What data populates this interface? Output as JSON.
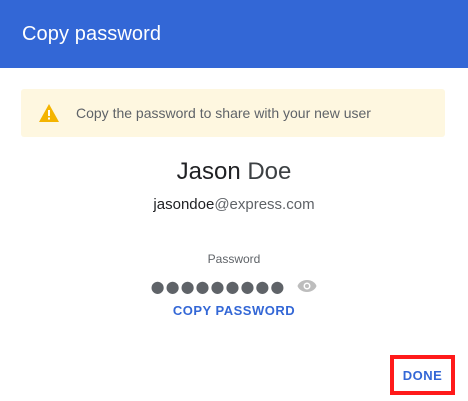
{
  "dialog": {
    "title": "Copy password"
  },
  "notice": {
    "icon": "warning-icon",
    "icon_color": "#f4b400",
    "text": "Copy the password to share with your new user",
    "background": "#fef7e0"
  },
  "user": {
    "first_name": "Jason",
    "last_name": "Doe",
    "email_local": "jasondoe",
    "email_domain": "@express.com"
  },
  "password": {
    "label": "Password",
    "masked_value": "●●●●●●●●●",
    "reveal_icon": "eye-icon"
  },
  "actions": {
    "copy_label": "COPY PASSWORD",
    "done_label": "DONE"
  },
  "colors": {
    "header": "#3367d6",
    "accent": "#3367d6",
    "highlight_border": "#ff1a1a"
  }
}
